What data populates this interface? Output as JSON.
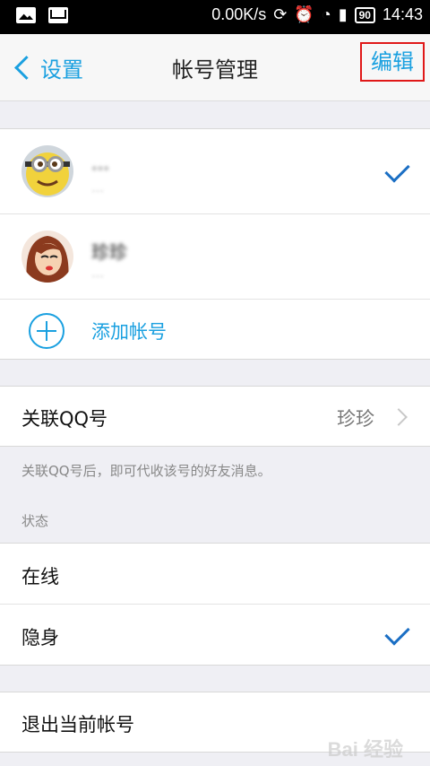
{
  "status_bar": {
    "speed": "0.00K/s",
    "battery": "90",
    "time": "14:43"
  },
  "nav": {
    "back_label": "设置",
    "title": "帐号管理",
    "edit_label": "编辑"
  },
  "accounts": [
    {
      "name": "…",
      "number": "…",
      "selected": true,
      "avatar": "minion-avatar"
    },
    {
      "name": "珍珍",
      "number": "…",
      "selected": false,
      "avatar": "girl-avatar"
    }
  ],
  "add_account_label": "添加帐号",
  "link_qq": {
    "label": "关联QQ号",
    "value": "珍珍"
  },
  "link_hint": "关联QQ号后，即可代收该号的好友消息。",
  "status_section": {
    "title": "状态",
    "options": [
      "在线",
      "隐身"
    ],
    "selected": "隐身"
  },
  "logout_label": "退出当前帐号",
  "colors": {
    "accent": "#1aa0e0",
    "check": "#1b6fc4",
    "highlight_box": "#e01818"
  }
}
